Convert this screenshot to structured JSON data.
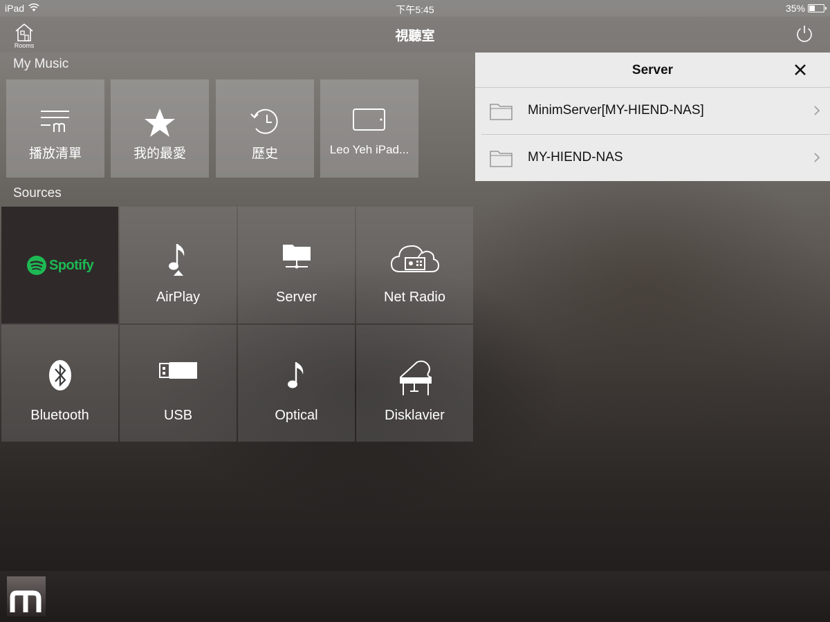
{
  "status_bar": {
    "device": "iPad",
    "time": "下午5:45",
    "battery_text": "35%",
    "battery_level": 0.35
  },
  "nav": {
    "title": "視聽室",
    "rooms_label": "Rooms"
  },
  "my_music": {
    "section_label": "My Music",
    "tiles": [
      {
        "label": "播放清單",
        "icon": "playlist-icon"
      },
      {
        "label": "我的最愛",
        "icon": "star-icon"
      },
      {
        "label": "歷史",
        "icon": "history-icon"
      },
      {
        "label": "Leo Yeh iPad...",
        "icon": "tablet-icon"
      }
    ]
  },
  "sources": {
    "section_label": "Sources",
    "spotify_text": "Spotify",
    "tiles": [
      {
        "label": "AirPlay",
        "icon": "airplay-note-icon"
      },
      {
        "label": "Server",
        "icon": "server-folder-icon"
      },
      {
        "label": "Net Radio",
        "icon": "cloud-radio-icon"
      },
      {
        "label": "Bluetooth",
        "icon": "bluetooth-icon"
      },
      {
        "label": "USB",
        "icon": "usb-icon"
      },
      {
        "label": "Optical",
        "icon": "music-note-icon"
      },
      {
        "label": "Disklavier",
        "icon": "piano-icon"
      }
    ]
  },
  "server_panel": {
    "title": "Server",
    "items": [
      {
        "label": "MinimServer[MY-HIEND-NAS]"
      },
      {
        "label": "MY-HIEND-NAS"
      }
    ]
  },
  "colors": {
    "spotify_green": "#1db954",
    "panel_bg": "#ebebeb"
  }
}
